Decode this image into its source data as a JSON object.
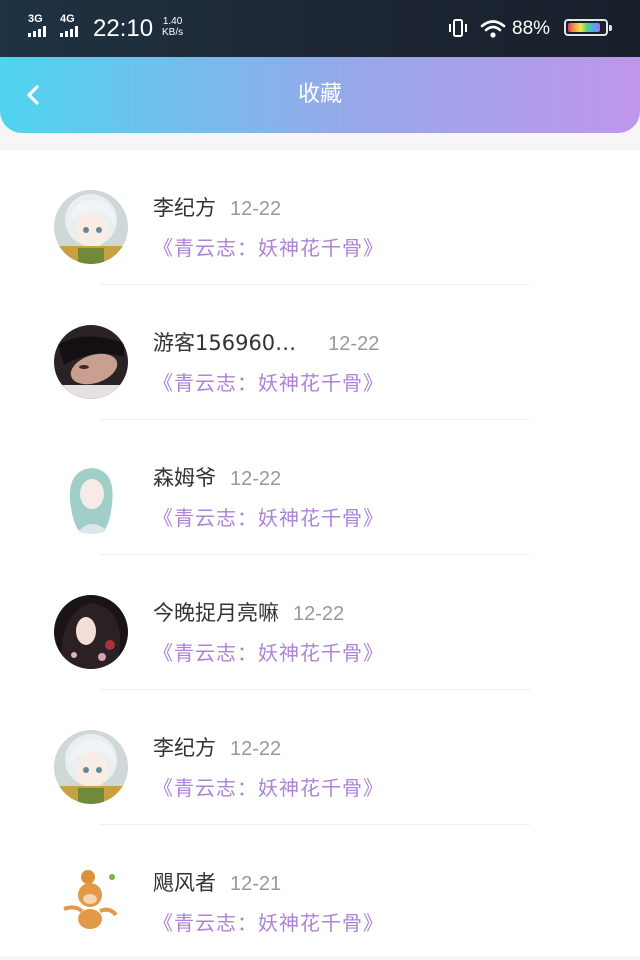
{
  "status_bar": {
    "network1": "3G",
    "network2": "4G",
    "time": "22:10",
    "speed_value": "1.40",
    "speed_unit": "KB/s",
    "battery_percent": "88%",
    "battery_level": 0.88
  },
  "header": {
    "title": "收藏",
    "back_icon": "chevron-left-icon",
    "gradient": [
      "#4fd4ef",
      "#bf96ea"
    ]
  },
  "items": [
    {
      "name": "李纪方",
      "date": "12-22",
      "book": "《青云志：妖神花千骨》",
      "avatar": "anime-girl-white-hair"
    },
    {
      "name": "游客156960…",
      "date": "12-22",
      "book": "《青云志：妖神花千骨》",
      "avatar": "man-dark-photo"
    },
    {
      "name": "森姆爷",
      "date": "12-22",
      "book": "《青云志：妖神花千骨》",
      "avatar": "girl-teal-hair-illustration"
    },
    {
      "name": "今晚捉月亮嘛",
      "date": "12-22",
      "book": "《青云志：妖神花千骨》",
      "avatar": "girl-dark-hair-floral"
    },
    {
      "name": "李纪方",
      "date": "12-22",
      "book": "《青云志：妖神花千骨》",
      "avatar": "anime-girl-white-hair"
    },
    {
      "name": "飓风者",
      "date": "12-21",
      "book": "《青云志：妖神花千骨》",
      "avatar": "cartoon-monkey-giraffe"
    }
  ],
  "colors": {
    "book_title": "#ad83d6",
    "name": "#333333",
    "date": "#999999"
  }
}
